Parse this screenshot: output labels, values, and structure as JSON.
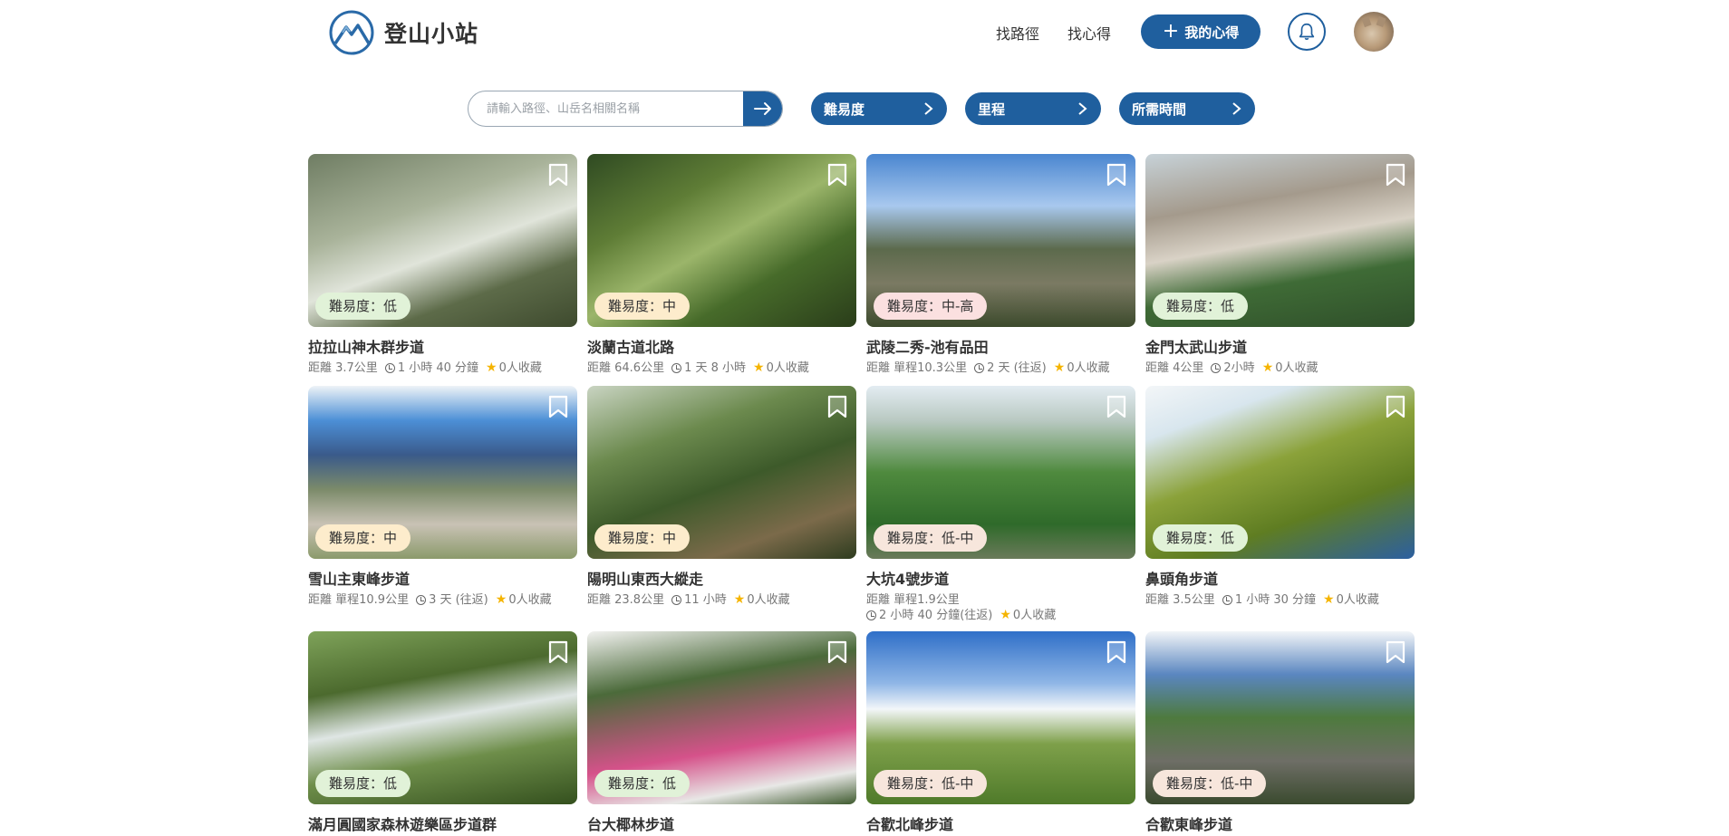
{
  "header": {
    "site_name": "登山小站",
    "nav": [
      "找路徑",
      "找心得"
    ],
    "my_post_label": "我的心得"
  },
  "search": {
    "placeholder": "請輸入路徑、山岳名相關名稱",
    "filters": [
      "難易度",
      "里程",
      "所需時間"
    ]
  },
  "colors": {
    "primary": "#1f5f9e",
    "star": "#f5b400"
  },
  "cards": [
    {
      "title": "拉拉山神木群步道",
      "difficulty": "難易度：低",
      "distance": "距離 3.7公里",
      "time": "1 小時 40 分鐘",
      "favorites": "0人收藏"
    },
    {
      "title": "淡蘭古道北路",
      "difficulty": "難易度：中",
      "distance": "距離 64.6公里",
      "time": "1 天 8 小時",
      "favorites": "0人收藏"
    },
    {
      "title": "武陵二秀-池有品田",
      "difficulty": "難易度：中-高",
      "distance": "距離 單程10.3公里",
      "time": "2 天 (往返)",
      "favorites": "0人收藏"
    },
    {
      "title": "金門太武山步道",
      "difficulty": "難易度：低",
      "distance": "距離 4公里",
      "time": "2小時",
      "favorites": "0人收藏"
    },
    {
      "title": "雪山主東峰步道",
      "difficulty": "難易度：中",
      "distance": "距離 單程10.9公里",
      "time": "3 天 (往返)",
      "favorites": "0人收藏"
    },
    {
      "title": "陽明山東西大縱走",
      "difficulty": "難易度：中",
      "distance": "距離 23.8公里",
      "time": "11 小時",
      "favorites": "0人收藏"
    },
    {
      "title": "大坑4號步道",
      "difficulty": "難易度：低-中",
      "distance": "距離 單程1.9公里",
      "time": "2 小時 40 分鐘(往返)",
      "favorites": "0人收藏"
    },
    {
      "title": "鼻頭角步道",
      "difficulty": "難易度：低",
      "distance": "距離 3.5公里",
      "time": "1 小時 30 分鐘",
      "favorites": "0人收藏"
    },
    {
      "title": "滿月圓國家森林遊樂區步道群",
      "difficulty": "難易度：低"
    },
    {
      "title": "台大椰林步道",
      "difficulty": "難易度：低"
    },
    {
      "title": "合歡北峰步道",
      "difficulty": "難易度：低-中"
    },
    {
      "title": "合歡東峰步道",
      "difficulty": "難易度：低-中"
    }
  ]
}
